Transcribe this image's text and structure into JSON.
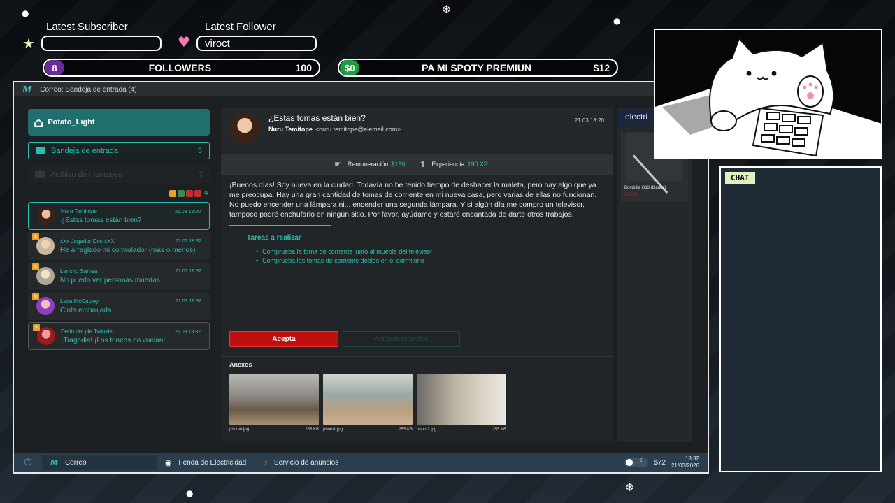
{
  "overlay": {
    "latest_subscriber_label": "Latest Subscriber",
    "latest_subscriber_value": "",
    "latest_follower_label": "Latest Follower",
    "latest_follower_value": "viroct",
    "followers": {
      "count": "8",
      "label": "FOLLOWERS",
      "goal": "100"
    },
    "donation": {
      "current": "$0",
      "label": "PA MI SPOTY PREMIUN",
      "goal": "$12"
    },
    "chat_label": "CHAT"
  },
  "window": {
    "title": "Correo: Bandeja de entrada (4)"
  },
  "sidebar": {
    "user": "Potato_Light",
    "folders": [
      {
        "label": "Bandeja de entrada",
        "count": "5"
      },
      {
        "label": "Archivo de mensajes",
        "count": "7"
      }
    ],
    "messages": [
      {
        "sender": "Nuru Temitope",
        "subject": "¿Estas tomas están bien?",
        "date": "21.03 18:20"
      },
      {
        "sender": "xXx Jugador Dos xXX",
        "subject": "He arreglado mi controlador (más o menos)",
        "date": "21.03 18:32"
      },
      {
        "sender": "Lencho Samsa",
        "subject": "No puedo ver personas muertas",
        "date": "21.03 18:32"
      },
      {
        "sender": "Lexa McCauley",
        "subject": "Cinta embrujada",
        "date": "21.03 18:32"
      },
      {
        "sender": "Dedo del pie Twinkle",
        "subject": "¡Tragedia! ¡Los trineos no vuelan!",
        "date": "21.03 18:32"
      }
    ]
  },
  "email": {
    "subject": "¿Estas tomas están bien?",
    "sender_name": "Nuru Temitope",
    "sender_email": "<nuru.temitope@elemail.com>",
    "date": "21.03 18:20",
    "reward_label": "Remuneración",
    "reward_value": "$150",
    "xp_label": "Experiencia",
    "xp_value": "190 XP",
    "body": "¡Buenos días! Soy nueva en la ciudad. Todavía no he tenido tiempo de deshacer la maleta, pero hay algo que ya me preocupa. Hay una gran cantidad de tomas de corriente en mi nueva casa, pero varias de ellas no funcionan. No puedo encender una lámpara ni... encender una segunda lámpara. Y si algún día me compro un televisor, tampoco podré enchufarlo en ningún sitio. Por favor, ayúdame y estaré encantada de darte otros trabajos.",
    "tasks_title": "Tareas a realizar",
    "tasks": [
      "Comprueba la toma de corriente junto al mueble del televisor",
      "Comprueba las tomas de corriente dobles en el dormitorio"
    ],
    "accept_label": "Acepta",
    "suggested_label": "Artículos sugeridos",
    "attachments_title": "Anexos",
    "attachments": [
      {
        "name": "photo0.jpg",
        "size": "255 KB"
      },
      {
        "name": "photo1.jpg",
        "size": "255 KB"
      },
      {
        "name": "photo2.jpg",
        "size": "255 KB"
      }
    ]
  },
  "shop": {
    "tag": "electri",
    "item_name": "Bombilla G13 (blanco)",
    "item_price": "$12.40"
  },
  "taskbar": {
    "items": [
      "Correo",
      "Tienda de Electricidad",
      "Servicio de anuncios"
    ],
    "money": "$72",
    "time": "18:32",
    "date": "21/03/2026"
  },
  "colors": {
    "accent": "#2ac0b0",
    "accept": "#c10f0f",
    "user_card": "#1f6f6e",
    "taskbar": "#2a3e4f"
  }
}
